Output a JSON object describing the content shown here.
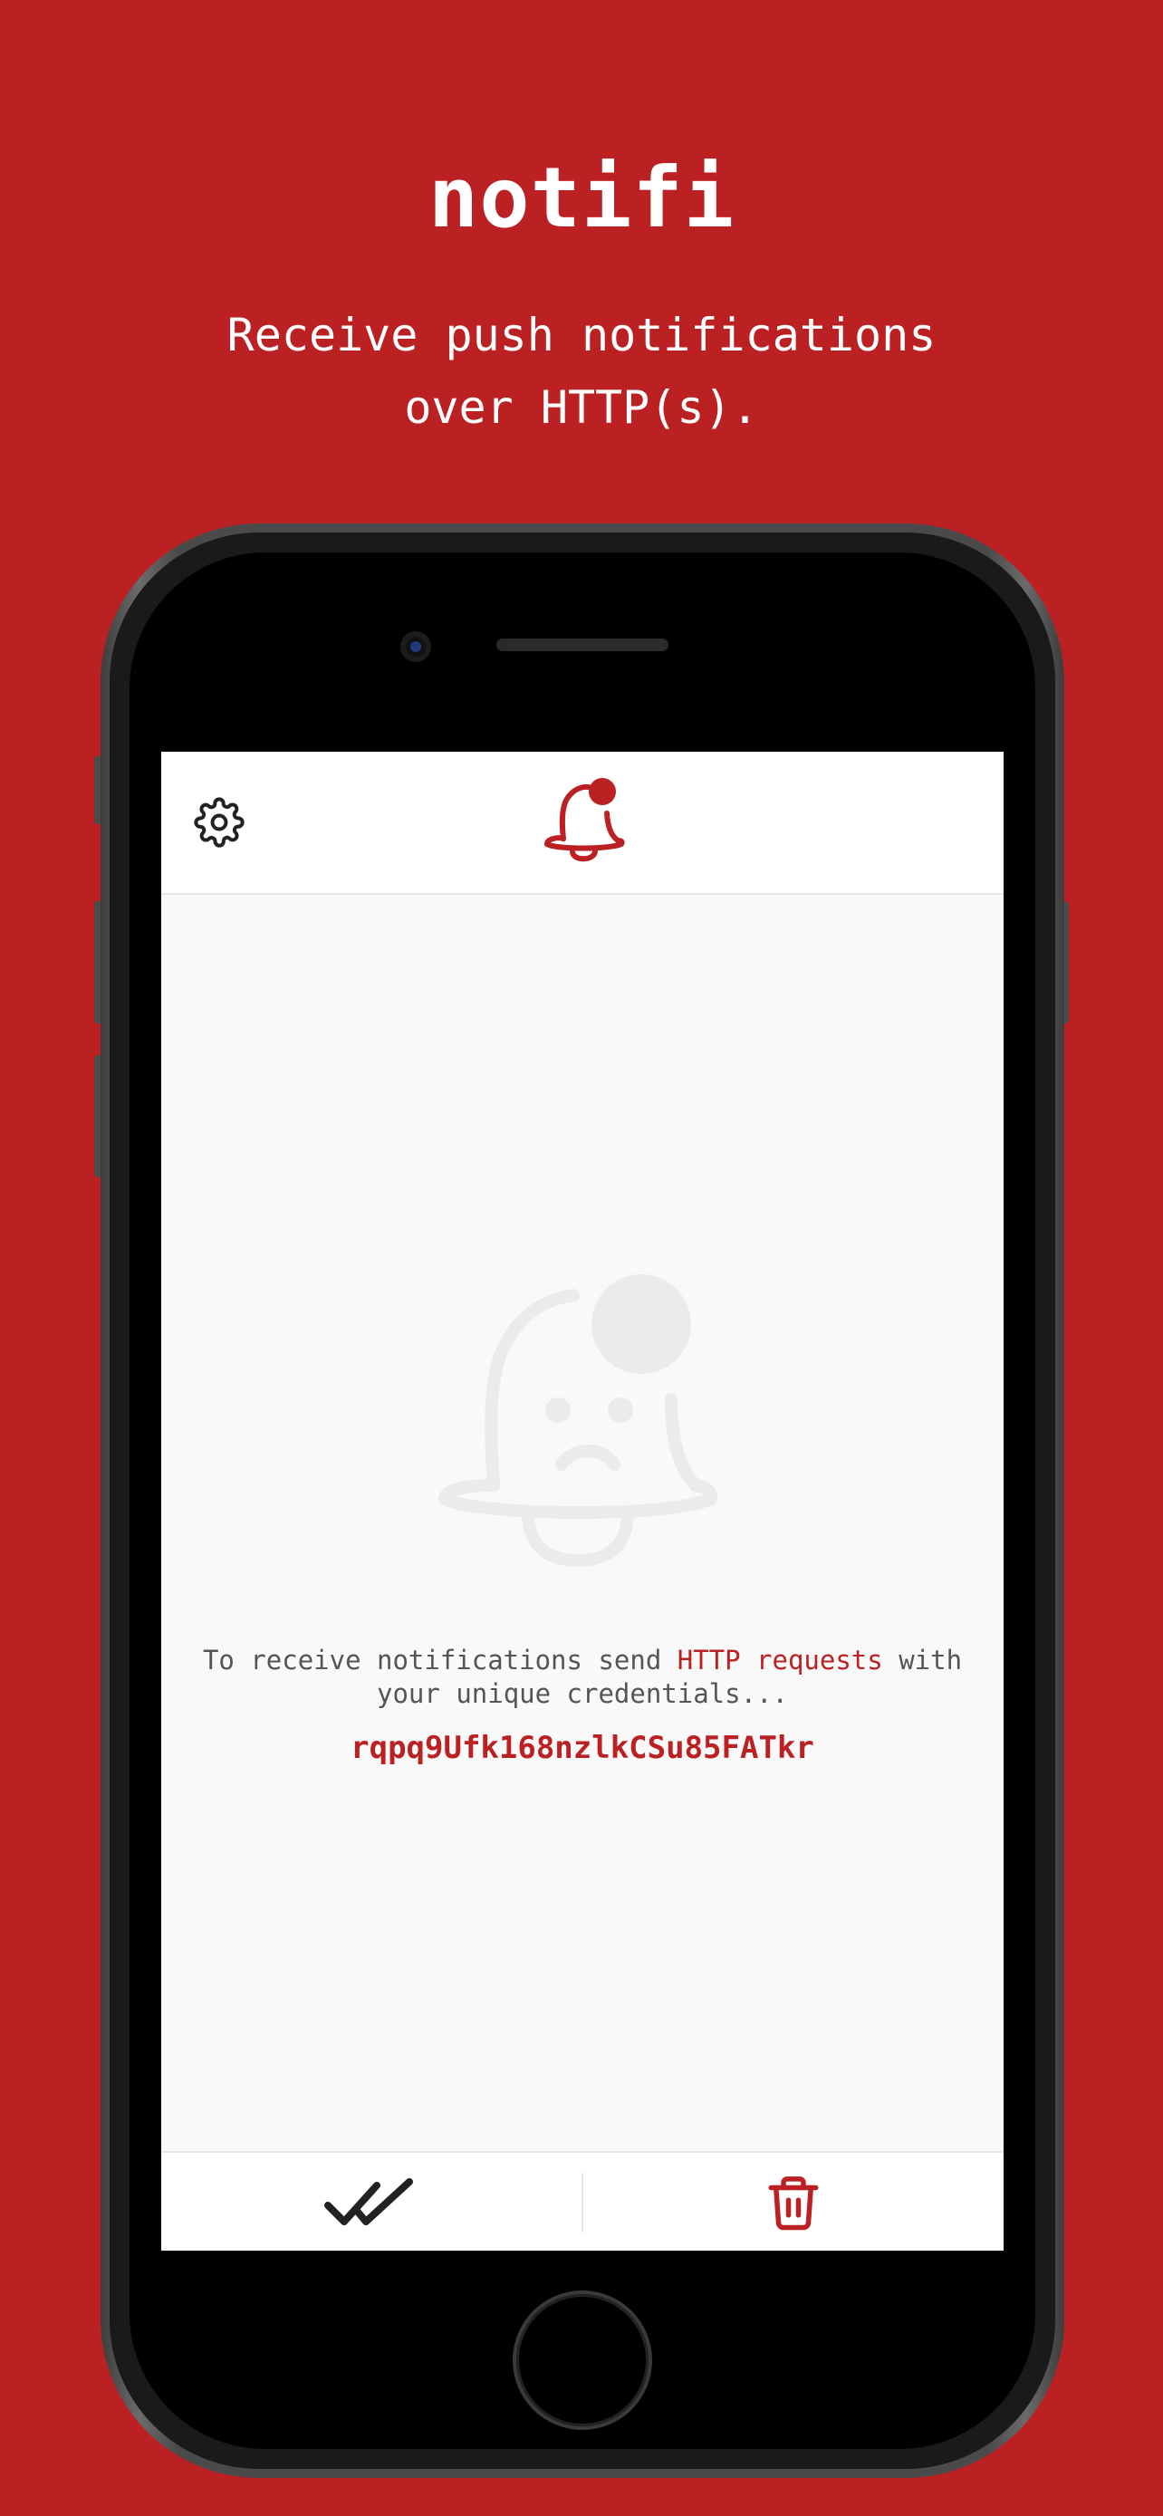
{
  "promo": {
    "app_name": "notifi",
    "tagline_line1": "Receive push notifications",
    "tagline_line2": "over HTTP(s)."
  },
  "app": {
    "header": {
      "settings_icon": "gear-icon",
      "logo_icon": "bell-with-badge-icon"
    },
    "empty_state": {
      "illustration": "sad-bell-icon",
      "message_before": "To receive notifications send ",
      "message_link": "HTTP requests",
      "message_after": " with your unique credentials...",
      "credentials": "rqpq9Ufk168nzlkCSu85FATkr"
    },
    "footer": {
      "mark_read_icon": "double-check-icon",
      "delete_icon": "trash-icon"
    }
  },
  "colors": {
    "brand_red": "#bb2023",
    "screen_bg": "#f9f9f9",
    "illustration_gray": "#ebebeb"
  }
}
